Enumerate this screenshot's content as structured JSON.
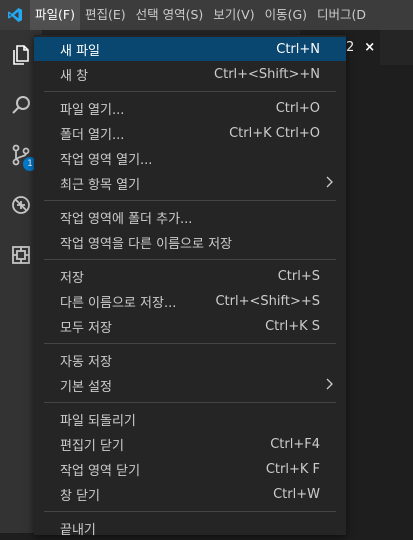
{
  "menubar": {
    "items": [
      {
        "label": "파일(F)"
      },
      {
        "label": "편집(E)"
      },
      {
        "label": "선택 영역(S)"
      },
      {
        "label": "보기(V)"
      },
      {
        "label": "이동(G)"
      },
      {
        "label": "디버그(D"
      }
    ]
  },
  "activity": {
    "icons": [
      "files-icon",
      "search-icon",
      "source-control-icon",
      "debug-icon",
      "extensions-icon"
    ],
    "badge": "1"
  },
  "tab": {
    "number": "2",
    "close": "×"
  },
  "file_menu": {
    "items": [
      {
        "label": "새 파일",
        "shortcut": "Ctrl+N",
        "selected": true
      },
      {
        "label": "새 창",
        "shortcut": "Ctrl+<Shift>+N"
      },
      {
        "label": "파일 열기...",
        "shortcut": "Ctrl+O"
      },
      {
        "label": "폴더 열기...",
        "shortcut": "Ctrl+K Ctrl+O"
      },
      {
        "label": "작업 영역 열기...",
        "shortcut": ""
      },
      {
        "label": "최근 항목 열기",
        "shortcut": "",
        "submenu": true
      },
      {
        "label": "작업 영역에 폴더 추가...",
        "shortcut": ""
      },
      {
        "label": "작업 영역을 다른 이름으로 저장",
        "shortcut": ""
      },
      {
        "label": "저장",
        "shortcut": "Ctrl+S"
      },
      {
        "label": "다른 이름으로 저장...",
        "shortcut": "Ctrl+<Shift>+S"
      },
      {
        "label": "모두 저장",
        "shortcut": "Ctrl+K S"
      },
      {
        "label": "자동 저장",
        "shortcut": ""
      },
      {
        "label": "기본 설정",
        "shortcut": "",
        "submenu": true
      },
      {
        "label": "파일 되돌리기",
        "shortcut": ""
      },
      {
        "label": "편집기 닫기",
        "shortcut": "Ctrl+F4"
      },
      {
        "label": "작업 영역 닫기",
        "shortcut": "Ctrl+K F"
      },
      {
        "label": "창 닫기",
        "shortcut": "Ctrl+W"
      },
      {
        "label": "끝내기",
        "shortcut": ""
      }
    ]
  },
  "colors": {
    "menubar": "#3c3c3c",
    "activitybar": "#333333",
    "menu_bg": "#252526",
    "selection": "#094771",
    "accent": "#007acc"
  }
}
